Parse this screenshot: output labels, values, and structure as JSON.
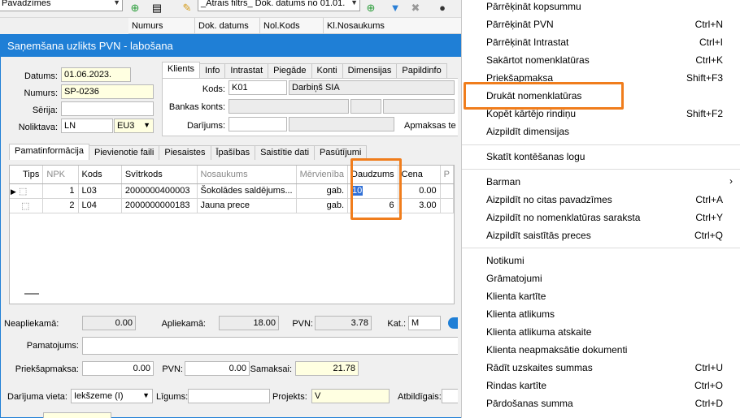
{
  "background": {
    "combo1": "Pavadzīmes",
    "filter_combo": "_Ātrais filtrs_ Dok. datums no 01.01.",
    "headers": [
      "Numurs",
      "Dok. datums",
      "Nol.Kods",
      "Kl.Nosaukums"
    ]
  },
  "dialog": {
    "title": "Saņemšana uzlikts PVN - labošana",
    "labels": {
      "datums": "Datums:",
      "numurs": "Numurs:",
      "serija": "Sērija:",
      "noliktava": "Noliktava:"
    },
    "values": {
      "datums": "01.06.2023.",
      "numurs": "SP-0236",
      "serija": "",
      "noliktava": "LN",
      "noliktava_code": "EU3"
    },
    "client_tabs": [
      "Klients",
      "Info",
      "Intrastat",
      "Piegāde",
      "Konti",
      "Dimensijas",
      "Papildinfo"
    ],
    "client": {
      "kods_label": "Kods:",
      "kods_value": "K01",
      "kods_name": "Darbiņš SIA",
      "bankas_label": "Bankas konts:",
      "darijums_label": "Darījums:",
      "apmaksas_label": "Apmaksas te"
    },
    "main_tabs": [
      "Pamatinformācija",
      "Pievienotie faili",
      "Piesaistes",
      "Īpašības",
      "Saistītie dati",
      "Pasūtījumi"
    ],
    "grid": {
      "columns": [
        "Tips",
        "NPK",
        "Kods",
        "Svītrkods",
        "Nosaukums",
        "Mērvienība",
        "Daudzums",
        "Cena",
        "P"
      ],
      "rows": [
        {
          "npk": "1",
          "kods": "L03",
          "svitrkods": "2000000400003",
          "nosaukums": "Šokolādes saldējums...",
          "mervieniba": "gab.",
          "daudzums": "10",
          "cena": "0.00"
        },
        {
          "npk": "2",
          "kods": "L04",
          "svitrkods": "2000000000183",
          "nosaukums": "Jauna prece",
          "mervieniba": "gab.",
          "daudzums": "6",
          "cena": "3.00"
        }
      ]
    },
    "totals": {
      "neapliekama_label": "Neapliekamā:",
      "neapliekama": "0.00",
      "apliekama_label": "Apliekamā:",
      "apliekama": "18.00",
      "pvn_label": "PVN:",
      "pvn": "3.78",
      "kat_label": "Kat.:",
      "kat": "M"
    },
    "pamatojums_label": "Pamatojums:",
    "payment": {
      "priekšapmaksa_label": "Priekšapmaksa:",
      "priekšapmaksa": "0.00",
      "pvn_label": "PVN:",
      "pvn": "0.00",
      "samaksai_label": "Samaksai:",
      "samaksai": "21.78"
    },
    "bottom": {
      "vieta_label": "Darījuma vieta:",
      "vieta": "Iekšzeme (I)",
      "ligums_label": "Līgums:",
      "projekts_label": "Projekts:",
      "projekts": "V",
      "atbildigais_label": "Atbildīgais:"
    }
  },
  "menu": {
    "items": [
      {
        "label": "Pārrēķināt kopsummu",
        "shortcut": ""
      },
      {
        "label": "Pārrēķināt PVN",
        "shortcut": "Ctrl+N"
      },
      {
        "label": "Pārrēķināt Intrastat",
        "shortcut": "Ctrl+I"
      },
      {
        "label": "Sakārtot nomenklatūras",
        "shortcut": "Ctrl+K"
      },
      {
        "label": "Priekšapmaksa",
        "shortcut": "Shift+F3"
      },
      {
        "label": "Drukāt nomenklatūras",
        "shortcut": ""
      },
      {
        "label": "Kopēt kārtējo rindiņu",
        "shortcut": "Shift+F2"
      },
      {
        "label": "Aizpildīt dimensijas",
        "shortcut": ""
      },
      {
        "label": "Skatīt kontēšanas logu",
        "shortcut": ""
      },
      {
        "label": "Barman",
        "shortcut": ""
      },
      {
        "label": "Aizpildīt no citas pavadzīmes",
        "shortcut": "Ctrl+A"
      },
      {
        "label": "Aizpildīt no nomenklatūras saraksta",
        "shortcut": "Ctrl+Y"
      },
      {
        "label": "Aizpildīt saistītās preces",
        "shortcut": "Ctrl+Q"
      },
      {
        "label": "Notikumi",
        "shortcut": ""
      },
      {
        "label": "Grāmatojumi",
        "shortcut": ""
      },
      {
        "label": "Klienta kartīte",
        "shortcut": ""
      },
      {
        "label": "Klienta atlikums",
        "shortcut": ""
      },
      {
        "label": "Klienta atlikuma atskaite",
        "shortcut": ""
      },
      {
        "label": "Klienta neapmaksātie dokumenti",
        "shortcut": ""
      },
      {
        "label": "Rādīt uzskaites summas",
        "shortcut": "Ctrl+U"
      },
      {
        "label": "Rindas kartīte",
        "shortcut": "Ctrl+O"
      },
      {
        "label": "Pārdošanas summa",
        "shortcut": "Ctrl+D"
      }
    ]
  },
  "colors": {
    "titlebar": "#1f7fd6",
    "highlight": "#f07d1c",
    "selection": "#2f6fd6"
  }
}
